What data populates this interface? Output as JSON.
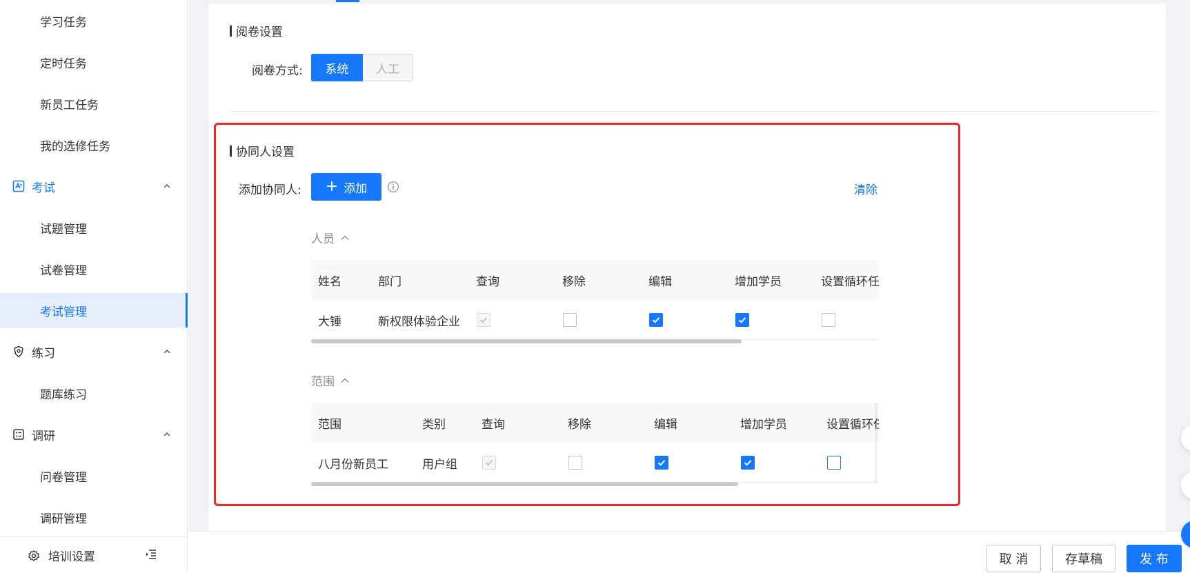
{
  "sidebar": {
    "items": [
      {
        "label": "学习任务"
      },
      {
        "label": "定时任务"
      },
      {
        "label": "新员工任务"
      },
      {
        "label": "我的选修任务"
      }
    ],
    "exam": {
      "label": "考试",
      "items": [
        {
          "label": "试题管理"
        },
        {
          "label": "试卷管理"
        },
        {
          "label": "考试管理"
        }
      ]
    },
    "practice": {
      "label": "练习",
      "items": [
        {
          "label": "题库练习"
        }
      ]
    },
    "survey": {
      "label": "调研",
      "items": [
        {
          "label": "问卷管理"
        },
        {
          "label": "调研管理"
        }
      ]
    },
    "footer": {
      "settings_label": "培训设置"
    }
  },
  "grading": {
    "section_title": "阅卷设置",
    "mode_label": "阅卷方式:",
    "options": [
      "系统",
      "人工"
    ],
    "selected": "系统"
  },
  "collaborators": {
    "section_title": "协同人设置",
    "add_label": "添加协同人:",
    "add_button": "添加",
    "add_plus": "+",
    "clear_label": "清除",
    "people": {
      "toggle_label": "人员",
      "columns": [
        "姓名",
        "部门",
        "查询",
        "移除",
        "编辑",
        "增加学员",
        "设置循环任务"
      ],
      "rows": [
        {
          "cells": [
            "大锤",
            "新权限体验企业"
          ],
          "query": "disabled-checked",
          "remove": false,
          "edit": true,
          "add_students": true,
          "cycle": false
        }
      ]
    },
    "scope": {
      "toggle_label": "范围",
      "columns": [
        "范围",
        "类别",
        "查询",
        "移除",
        "编辑",
        "增加学员",
        "设置循环任务"
      ],
      "rows": [
        {
          "cells": [
            "八月份新员工",
            "用户组"
          ],
          "query": "disabled-checked",
          "remove": false,
          "edit": true,
          "add_students": true,
          "cycle": false
        }
      ]
    }
  },
  "footer": {
    "cancel": "取 消",
    "draft": "存草稿",
    "publish": "发 布"
  },
  "colors": {
    "primary": "#1677ff",
    "highlight_border": "#f5222d"
  }
}
